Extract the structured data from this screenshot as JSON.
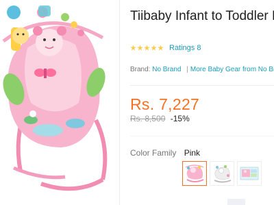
{
  "product": {
    "title": "Tiibaby Infant to Toddler R"
  },
  "rating": {
    "stars": 5,
    "ratings_label": "Ratings 8"
  },
  "brand": {
    "label": "Brand:",
    "name": "No Brand",
    "separator": "|",
    "more_link": "More Baby Gear from No Br"
  },
  "pricing": {
    "price": "Rs. 7,227",
    "original_price": "Rs. 8,500",
    "discount": "-15%"
  },
  "variant": {
    "label": "Color Family",
    "selected_value": "Pink",
    "swatches": [
      "rocker-pink-thumbnail",
      "rocker-white-thumbnail",
      "rocker-box-thumbnail"
    ]
  },
  "colors": {
    "accent": "#f57224",
    "link": "#1a9cb7",
    "star": "#faca51",
    "product_pink": "#f7a8c4"
  }
}
